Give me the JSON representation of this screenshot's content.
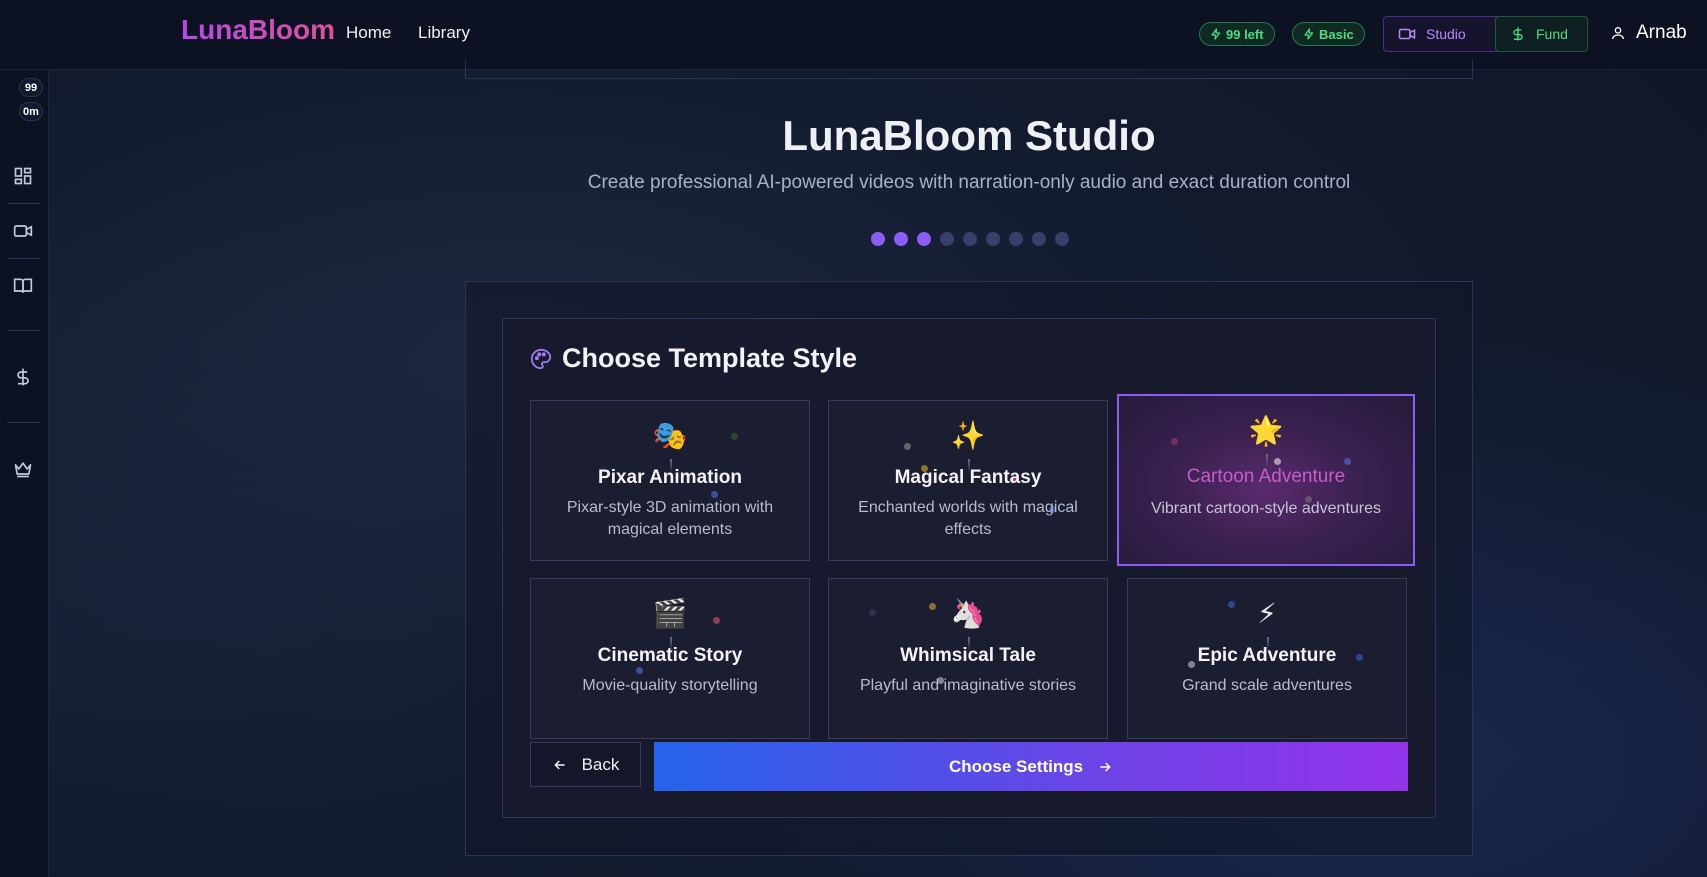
{
  "header": {
    "logo": "LunaBloom",
    "nav": [
      {
        "label": "Home"
      },
      {
        "label": "Library"
      }
    ],
    "credits_pill": "99 left",
    "plan_pill": "Basic",
    "studio_label": "Studio",
    "fund_label": "Fund",
    "user_name": "Arnab"
  },
  "sidebar": {
    "badges": [
      "99",
      "0m"
    ],
    "icons": [
      "grid-icon",
      "video-icon",
      "book-icon",
      "dollar-icon",
      "crown-icon"
    ]
  },
  "main": {
    "title": "LunaBloom Studio",
    "subtitle": "Create professional AI-powered videos with narration-only audio and exact duration control",
    "steps_total": 9,
    "steps_completed": 3,
    "section_title": "Choose Template Style",
    "templates": [
      {
        "emoji": "🎭",
        "title": "Pixar Animation",
        "desc": "Pixar-style 3D animation with magical elements",
        "selected": false
      },
      {
        "emoji": "✨",
        "title": "Magical Fantasy",
        "desc": "Enchanted worlds with magical effects",
        "selected": false
      },
      {
        "emoji": "🌟",
        "title": "Cartoon Adventure",
        "desc": "Vibrant cartoon-style adventures",
        "selected": true
      },
      {
        "emoji": "🎬",
        "title": "Cinematic Story",
        "desc": "Movie-quality storytelling",
        "selected": false
      },
      {
        "emoji": "🦄",
        "title": "Whimsical Tale",
        "desc": "Playful and imaginative stories",
        "selected": false
      },
      {
        "emoji": "⚡",
        "title": "Epic Adventure",
        "desc": "Grand scale adventures",
        "selected": false
      }
    ],
    "back_label": "Back",
    "next_label": "Choose Settings"
  },
  "colors": {
    "accent": "#8b5cf6",
    "success": "#4ade80",
    "gradient_start": "#2563eb",
    "gradient_end": "#9333ea"
  }
}
